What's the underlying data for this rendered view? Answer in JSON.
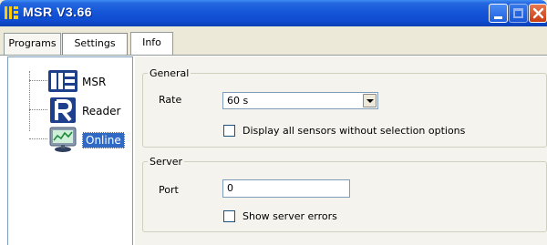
{
  "window": {
    "title": "MSR V3.66"
  },
  "tabs": [
    {
      "label": "Programs"
    },
    {
      "label": "Settings"
    },
    {
      "label": "Info"
    }
  ],
  "tree": {
    "items": [
      {
        "label": "MSR",
        "icon": "msr-icon"
      },
      {
        "label": "Reader",
        "icon": "reader-icon"
      },
      {
        "label": "Online",
        "icon": "monitor-icon",
        "selected": true
      }
    ]
  },
  "general": {
    "title": "General",
    "rate_label": "Rate",
    "rate_value": "60 s",
    "display_all_label": "Display all sensors without selection options",
    "display_all_checked": false
  },
  "server": {
    "title": "Server",
    "port_label": "Port",
    "port_value": "0",
    "show_errors_label": "Show server errors",
    "show_errors_checked": false
  },
  "colors": {
    "titlebar": "#1556D8",
    "selection": "#316AC5",
    "panel_bg": "#F4F3EE"
  }
}
